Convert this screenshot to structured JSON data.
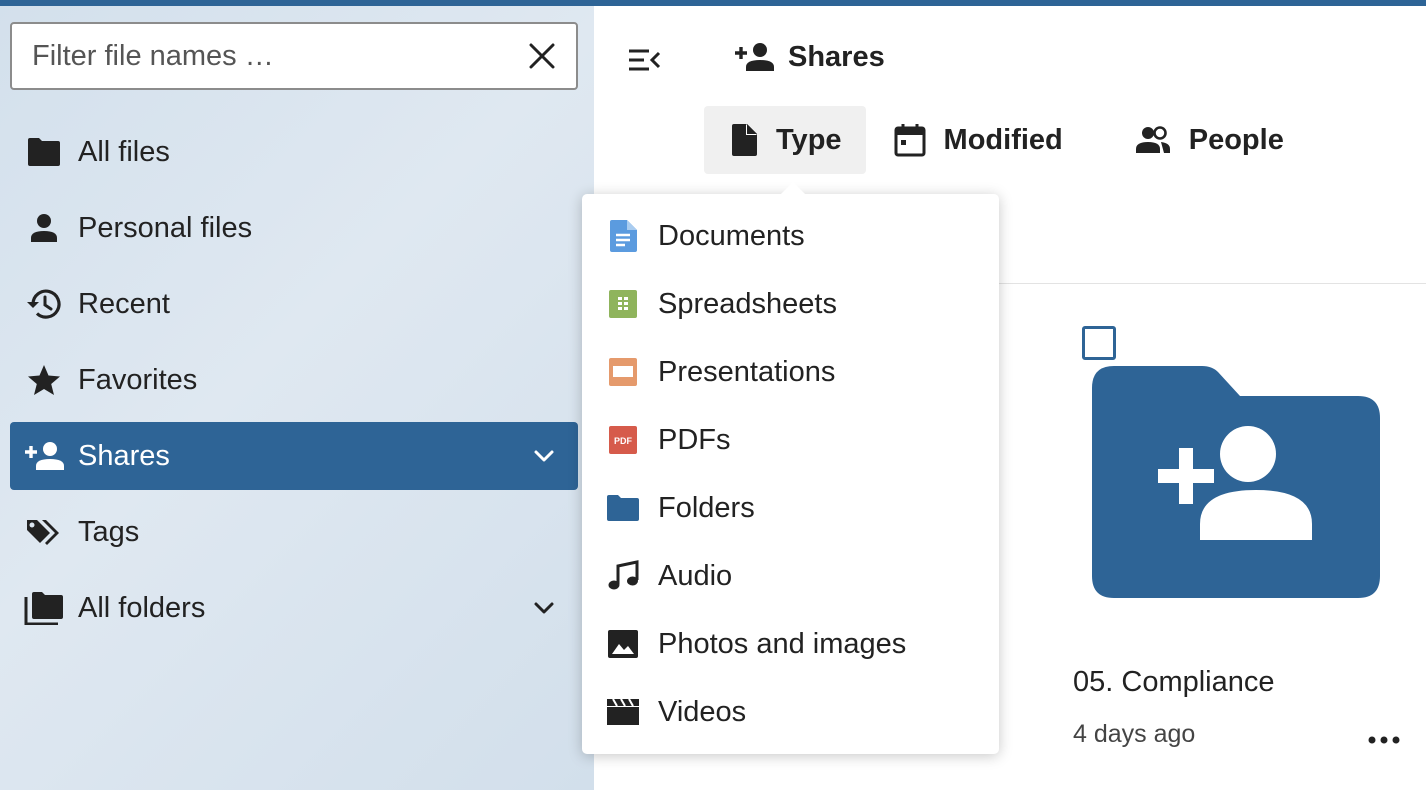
{
  "colors": {
    "accent": "#2e6496",
    "sidebar_bg": "#d6e2ee",
    "document": "#5b9bdf",
    "spreadsheet": "#8fb45c",
    "presentation": "#e59a6c",
    "pdf": "#d65b4b"
  },
  "search": {
    "placeholder": "Filter file names …",
    "value": ""
  },
  "sidebar": {
    "items": [
      {
        "label": "All files",
        "icon": "folder-icon"
      },
      {
        "label": "Personal files",
        "icon": "account-icon"
      },
      {
        "label": "Recent",
        "icon": "history-icon"
      },
      {
        "label": "Favorites",
        "icon": "star-icon"
      },
      {
        "label": "Shares",
        "icon": "account-plus-icon",
        "active": true,
        "expandable": true
      },
      {
        "label": "Tags",
        "icon": "tag-multiple-icon"
      },
      {
        "label": "All folders",
        "icon": "folder-multiple-icon",
        "expandable": true
      }
    ]
  },
  "header": {
    "title": "Shares"
  },
  "filters": {
    "type": "Type",
    "modified": "Modified",
    "people": "People"
  },
  "type_menu": {
    "items": [
      {
        "label": "Documents",
        "icon": "document-icon"
      },
      {
        "label": "Spreadsheets",
        "icon": "spreadsheet-icon"
      },
      {
        "label": "Presentations",
        "icon": "presentation-icon"
      },
      {
        "label": "PDFs",
        "icon": "pdf-icon",
        "badge": "PDF"
      },
      {
        "label": "Folders",
        "icon": "folder-icon"
      },
      {
        "label": "Audio",
        "icon": "music-note-icon"
      },
      {
        "label": "Photos and images",
        "icon": "image-icon"
      },
      {
        "label": "Videos",
        "icon": "clapperboard-icon"
      }
    ]
  },
  "files": [
    {
      "name": "05. Compliance",
      "modified": "4 days ago",
      "icon": "shared-folder-icon"
    }
  ]
}
